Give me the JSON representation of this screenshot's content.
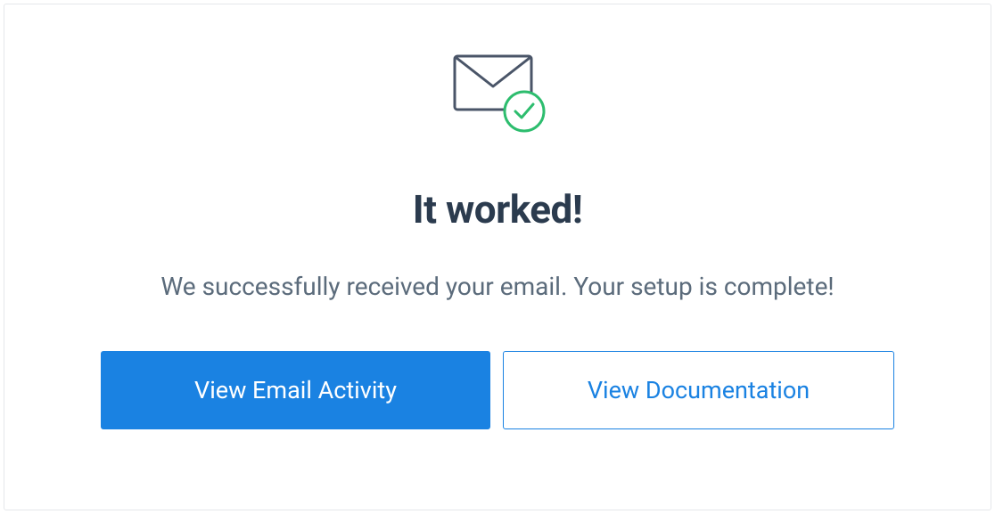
{
  "heading": "It worked!",
  "subtext": "We successfully received your email. Your setup is complete!",
  "buttons": {
    "primary": "View Email Activity",
    "secondary": "View Documentation"
  },
  "colors": {
    "accent": "#1a82e2",
    "success": "#2dbd6e",
    "heading": "#2b3b4e",
    "body": "#5b6b7b"
  }
}
